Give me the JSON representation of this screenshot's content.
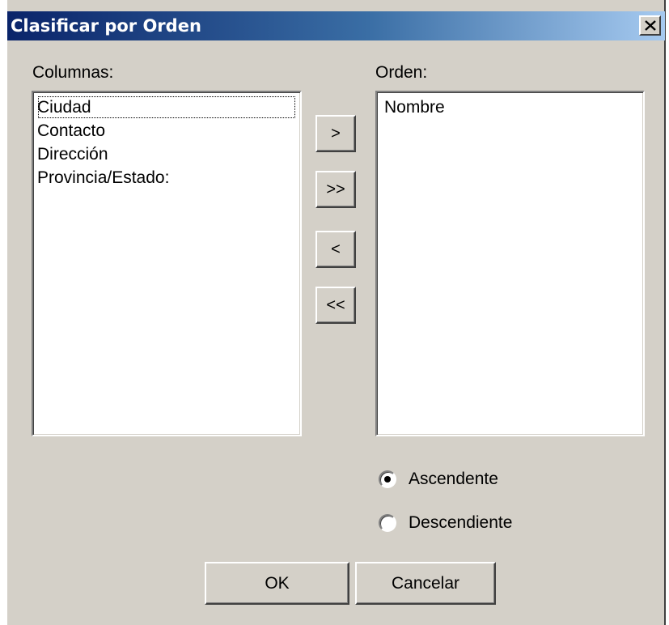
{
  "dialog": {
    "title": "Clasificar por Orden",
    "close_glyph": "close-icon"
  },
  "columns": {
    "label": "Columnas:",
    "items": [
      "Ciudad",
      "Contacto",
      "Dirección",
      "Provincia/Estado:"
    ],
    "focused_index": 0
  },
  "order": {
    "label": "Orden:",
    "items": [
      "Nombre"
    ]
  },
  "move_buttons": {
    "add_one": ">",
    "add_all": ">>",
    "remove_one": "<",
    "remove_all": "<<"
  },
  "sort_direction": {
    "ascending_label": "Ascendente",
    "descending_label": "Descendiente",
    "selected": "ascending"
  },
  "footer": {
    "ok_label": "OK",
    "cancel_label": "Cancelar"
  },
  "colors": {
    "face": "#d4d0c8",
    "title_start": "#0a246a",
    "title_end": "#a6caf0"
  }
}
